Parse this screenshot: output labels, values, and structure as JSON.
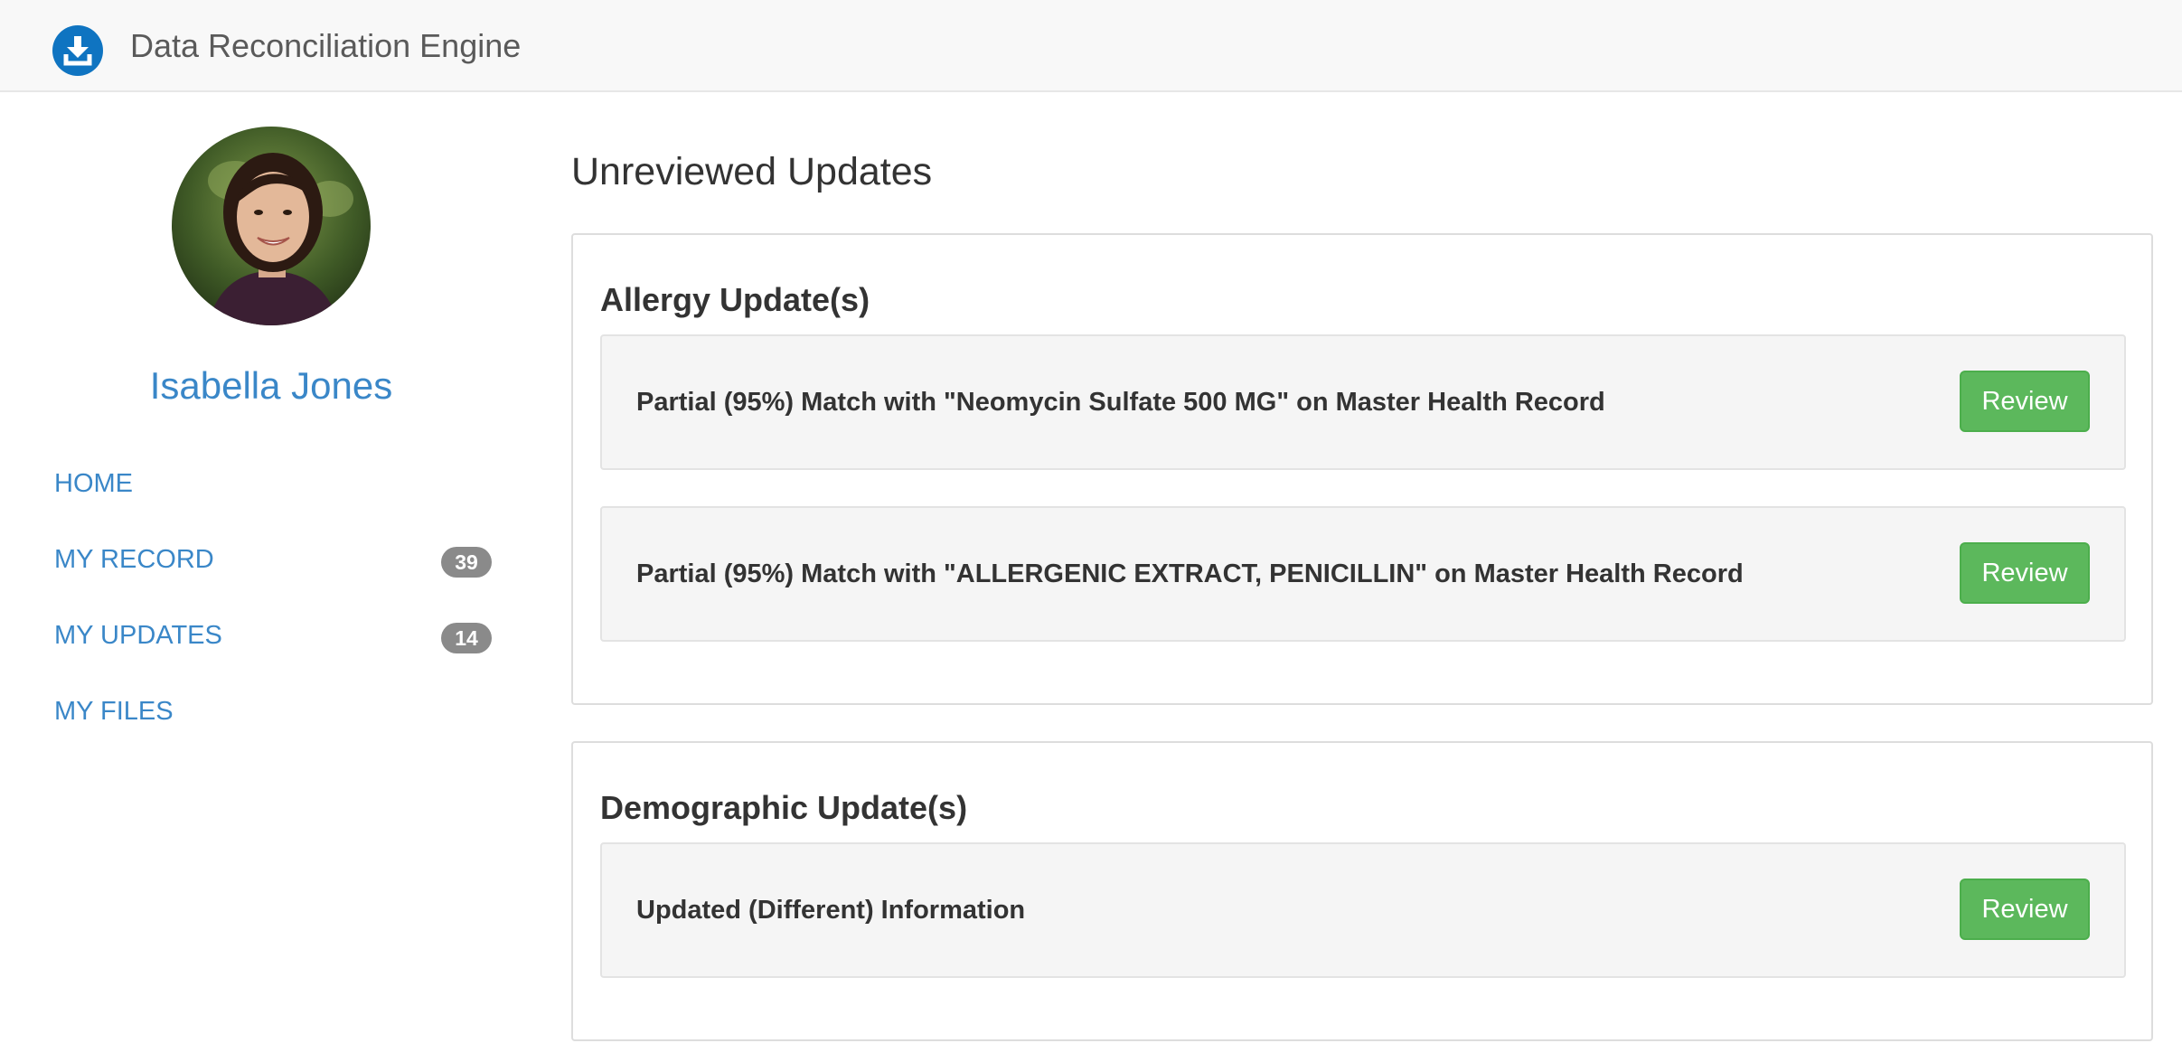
{
  "app": {
    "title": "Data Reconciliation Engine",
    "brand_icon": "download-icon",
    "brand_color": "#0f74c1"
  },
  "user": {
    "name": "Isabella Jones"
  },
  "sidebar": {
    "items": [
      {
        "label": "HOME",
        "badge": null
      },
      {
        "label": "MY RECORD",
        "badge": "39"
      },
      {
        "label": "MY UPDATES",
        "badge": "14"
      },
      {
        "label": "MY FILES",
        "badge": null
      }
    ]
  },
  "main": {
    "title": "Unreviewed Updates",
    "sections": [
      {
        "heading": "Allergy Update(s)",
        "updates": [
          {
            "text": "Partial (95%) Match with \"Neomycin Sulfate 500 MG\" on Master Health Record",
            "action": "Review"
          },
          {
            "text": "Partial (95%) Match with \"ALLERGENIC EXTRACT, PENICILLIN\" on Master Health Record",
            "action": "Review"
          }
        ]
      },
      {
        "heading": "Demographic Update(s)",
        "updates": [
          {
            "text": "Updated (Different) Information",
            "action": "Review"
          }
        ]
      }
    ]
  },
  "colors": {
    "link": "#3a87c8",
    "button": "#5cb85c",
    "badge": "#8a8a8a"
  }
}
